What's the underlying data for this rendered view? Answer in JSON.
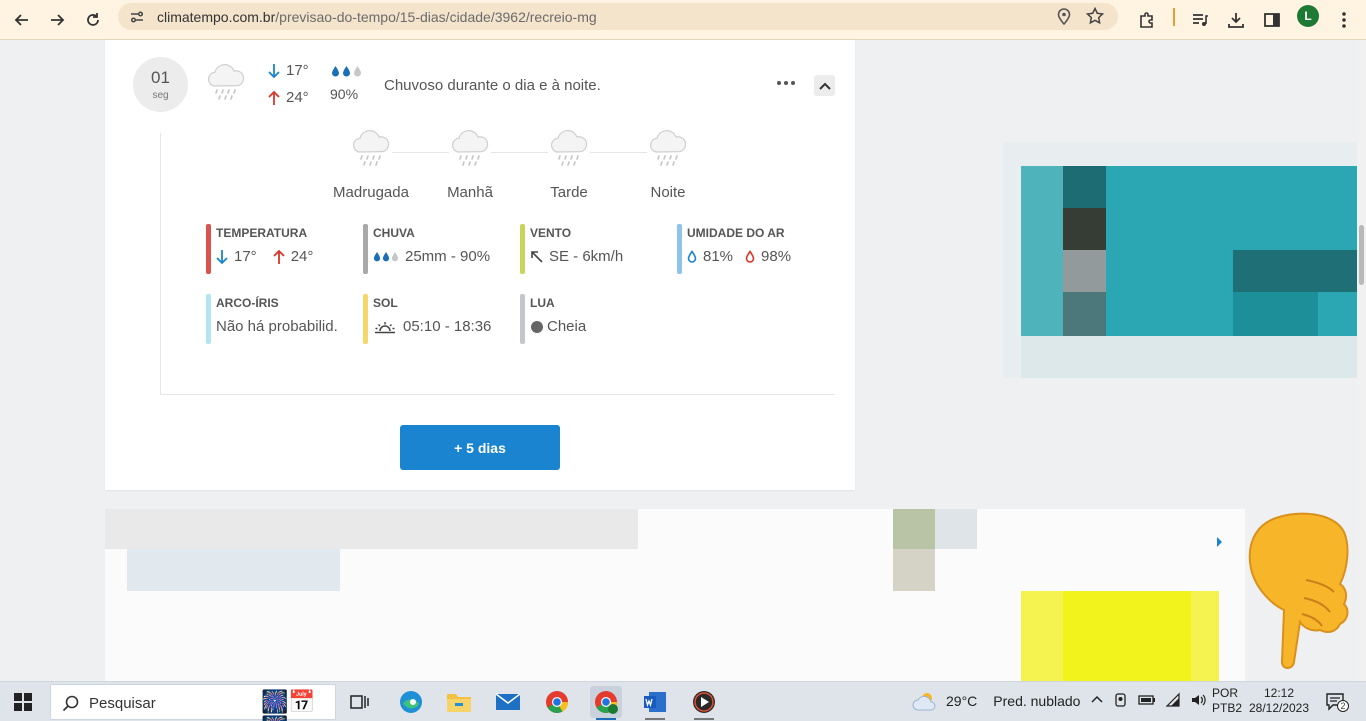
{
  "browser": {
    "url_domain": "climatempo.com.br",
    "url_path": "/previsao-do-tempo/15-dias/cidade/3962/recreio-mg",
    "profile_initial": "L"
  },
  "forecast": {
    "day_number": "01",
    "weekday": "seg",
    "temp_min": "17°",
    "temp_max": "24°",
    "rain_prob": "90%",
    "summary": "Chuvoso durante o dia e à noite.",
    "periods": [
      {
        "label": "Madrugada",
        "icon": "rain-cloud-icon"
      },
      {
        "label": "Manhã",
        "icon": "rain-cloud-icon"
      },
      {
        "label": "Tarde",
        "icon": "rain-cloud-icon"
      },
      {
        "label": "Noite",
        "icon": "rain-cloud-icon"
      }
    ],
    "details": {
      "temperature": {
        "title": "TEMPERATURA",
        "min": "17°",
        "max": "24°",
        "color": "#d9534f"
      },
      "rain": {
        "title": "CHUVA",
        "value": "25mm - 90%",
        "color": "#a9a9a9"
      },
      "wind": {
        "title": "VENTO",
        "value": "SE - 6km/h",
        "color": "#c8d45a"
      },
      "humidity": {
        "title": "UMIDADE DO AR",
        "min": "81%",
        "max": "98%",
        "color": "#8fc3ea"
      },
      "rainbow": {
        "title": "ARCO-ÍRIS",
        "value": "Não há probabilid.",
        "color": "#b2e6ef"
      },
      "sun": {
        "title": "SOL",
        "value": "05:10 - 18:36",
        "color": "#f5d76e"
      },
      "moon": {
        "title": "LUA",
        "value": "Cheia",
        "color": "#c2c7cc"
      }
    },
    "more_days_label": "+ 5 dias"
  },
  "taskbar": {
    "search_placeholder": "Pesquisar",
    "weather_temp": "29°C",
    "weather_desc": "Pred. nublado",
    "lang_1": "POR",
    "lang_2": "PTB2",
    "time": "12:12",
    "date": "28/12/2023",
    "notifications": "2"
  },
  "colors": {
    "accent_blue": "#1a84d0",
    "arrow_down": "#1a84d0",
    "arrow_up": "#d9352a"
  }
}
